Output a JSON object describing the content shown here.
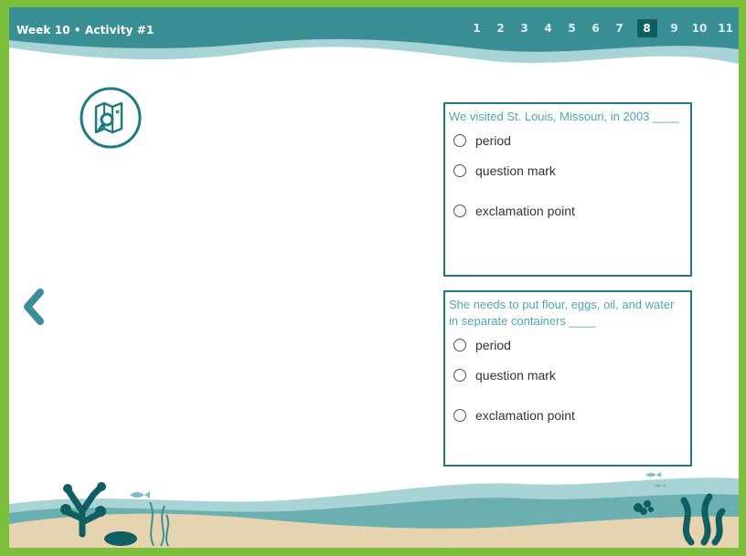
{
  "header": {
    "title": "Week 10 • Activity #1",
    "pages": [
      "1",
      "2",
      "3",
      "4",
      "5",
      "6",
      "7",
      "8",
      "9",
      "10",
      "11"
    ],
    "current_page": "8"
  },
  "icons": {
    "top_left": "map-search-icon",
    "back": "chevron-left-icon"
  },
  "questions": [
    {
      "text": "We visited St. Louis, Missouri, in 2003 ____",
      "options": [
        "period",
        "question mark",
        "exclamation point"
      ]
    },
    {
      "text": "She needs to put flour, eggs, oil, and water in separate containers ____",
      "options": [
        "period",
        "question mark",
        "exclamation point"
      ]
    }
  ],
  "colors": {
    "frame": "#7bbf3c",
    "header_teal": "#3a8f94",
    "accent": "#1e7b7f",
    "question_text": "#4fa8ab",
    "sand": "#e6d3b0"
  }
}
